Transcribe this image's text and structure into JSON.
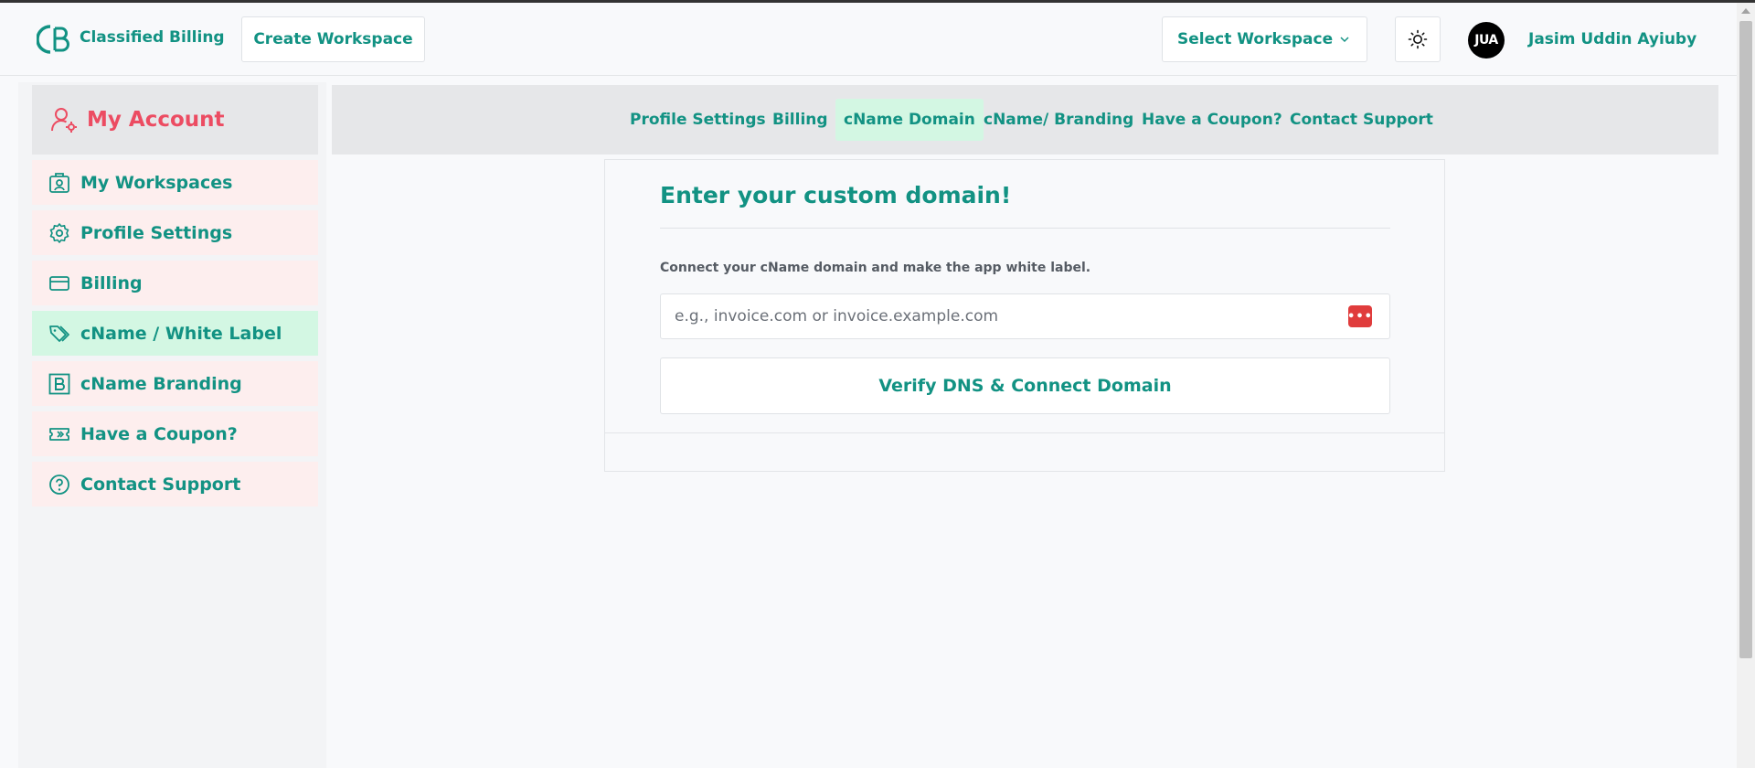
{
  "header": {
    "brand": "Classified Billing",
    "create_workspace": "Create Workspace",
    "select_workspace": "Select Workspace",
    "avatar_initials": "JUA",
    "user_name": "Jasim Uddin Ayiuby"
  },
  "sidebar": {
    "title": "My Account",
    "items": [
      {
        "label": "My Workspaces",
        "icon": "workspaces-icon"
      },
      {
        "label": "Profile Settings",
        "icon": "gear-icon"
      },
      {
        "label": "Billing",
        "icon": "credit-card-icon"
      },
      {
        "label": "cName / White Label",
        "icon": "tags-icon",
        "active": true
      },
      {
        "label": "cName Branding",
        "icon": "branding-b-icon"
      },
      {
        "label": "Have a Coupon?",
        "icon": "ticket-icon"
      },
      {
        "label": "Contact Support",
        "icon": "help-circle-icon"
      }
    ]
  },
  "tabs": [
    {
      "label": "Profile Settings"
    },
    {
      "label": "Billing"
    },
    {
      "label": "cName Domain",
      "active": true
    },
    {
      "label": "cName/ Branding"
    },
    {
      "label": "Have a Coupon?"
    },
    {
      "label": "Contact Support"
    }
  ],
  "card": {
    "title": "Enter your custom domain!",
    "description": "Connect your cName domain and make the app white label.",
    "input_placeholder": "e.g., invoice.com or invoice.example.com",
    "input_value": "",
    "verify_button": "Verify DNS & Connect Domain"
  },
  "colors": {
    "primary": "#129283",
    "accent_red": "#ec4c62",
    "active_bg": "#d3f7e3",
    "item_bg": "#fdeeee"
  }
}
